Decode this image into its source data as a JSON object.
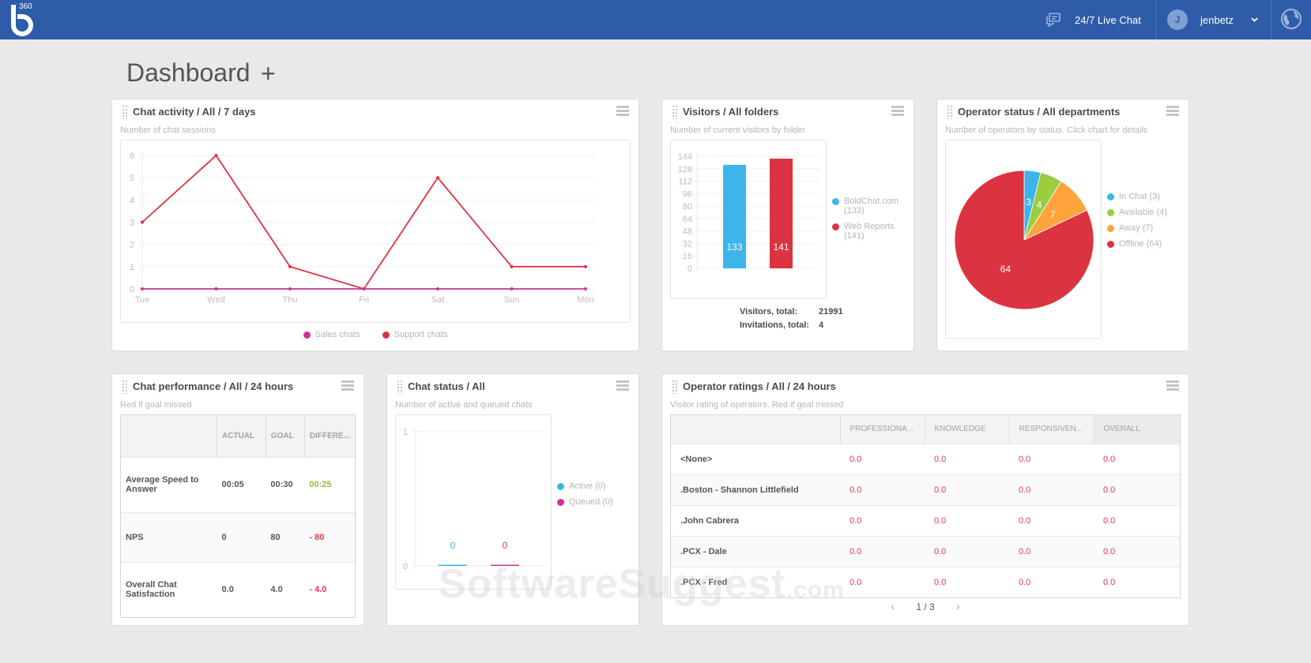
{
  "app": {
    "logo_text": "360",
    "live_chat_label": "24/7 Live Chat",
    "user_initial": "J",
    "username": "jenbetz"
  },
  "page": {
    "title": "Dashboard",
    "add_label": "+"
  },
  "widgets": {
    "chat_activity": {
      "title": "Chat activity / All / 7 days",
      "subtitle": "Number of chat sessions"
    },
    "visitors": {
      "title": "Visitors / All folders",
      "subtitle": "Number of current visitors by folder",
      "legend": [
        "BoldChat.com (133)",
        "Web Reports (141)"
      ],
      "totals": [
        {
          "label": "Visitors, total:",
          "value": "21991"
        },
        {
          "label": "Invitations, total:",
          "value": "4"
        }
      ]
    },
    "operator_status": {
      "title": "Operator status / All departments",
      "subtitle": "Number of operators by status. Click chart for details",
      "legend": [
        "In Chat (3)",
        "Available (4)",
        "Away (7)",
        "Offline (64)"
      ]
    },
    "chat_performance": {
      "title": "Chat performance / All / 24 hours",
      "subtitle": "Red if goal missed",
      "columns": [
        "",
        "ACTUAL",
        "GOAL",
        "DIFFERE..."
      ],
      "rows": [
        {
          "metric": "Average Speed to Answer",
          "actual": "00:05",
          "goal": "00:30",
          "difference": "00:25",
          "status": "good"
        },
        {
          "metric": "NPS",
          "actual": "0",
          "goal": "80",
          "difference": "- 80",
          "status": "missed"
        },
        {
          "metric": "Overall Chat Satisfaction",
          "actual": "0.0",
          "goal": "4.0",
          "difference": "- 4.0",
          "status": "missed"
        }
      ]
    },
    "chat_status": {
      "title": "Chat status / All",
      "subtitle": "Number of active and queued chats",
      "legend": [
        "Active (0)",
        "Queued (0)"
      ]
    },
    "operator_ratings": {
      "title": "Operator ratings / All / 24 hours",
      "subtitle": "Visitor rating of operators. Red if goal missed",
      "columns": [
        "",
        "PROFESSIONA...",
        "KNOWLEDGE",
        "RESPONSIVEN...",
        "OVERALL"
      ],
      "rows": [
        {
          "name": "<None>",
          "values": [
            "0.0",
            "0.0",
            "0.0",
            "0.0"
          ]
        },
        {
          "name": ".Boston - Shannon Littlefield",
          "values": [
            "0.0",
            "0.0",
            "0.0",
            "0.0"
          ]
        },
        {
          "name": ".John Cabrera",
          "values": [
            "0.0",
            "0.0",
            "0.0",
            "0.0"
          ]
        },
        {
          "name": ".PCX - Dale",
          "values": [
            "0.0",
            "0.0",
            "0.0",
            "0.0"
          ]
        },
        {
          "name": ".PCX - Fred",
          "values": [
            "0.0",
            "0.0",
            "0.0",
            "0.0"
          ]
        }
      ],
      "pager": "1 / 3"
    }
  },
  "colors": {
    "brand": "#2f5ca8",
    "red": "#dc3340",
    "blue": "#3db5ea",
    "magenta": "#cc3399",
    "green": "#9acd3f",
    "orange": "#ffa43c"
  },
  "watermark": {
    "main": "SoftwareSuggest",
    "suffix": ".com"
  },
  "chart_data": [
    {
      "type": "line",
      "title": "Chat activity / All / 7 days",
      "x": [
        "Tue",
        "Wed",
        "Thu",
        "Fri",
        "Sat",
        "Sun",
        "Mon"
      ],
      "series": [
        {
          "name": "Sales chats",
          "color": "#cc3399",
          "values": [
            0,
            0,
            0,
            0,
            0,
            0,
            0
          ]
        },
        {
          "name": "Support chats",
          "color": "#dc3340",
          "values": [
            3,
            6,
            1,
            0,
            5,
            1,
            1
          ]
        }
      ],
      "yticks": [
        0,
        1,
        2,
        3,
        4,
        5,
        6
      ],
      "ylim": [
        0,
        6
      ],
      "grid": true,
      "legend": "bottom"
    },
    {
      "type": "bar",
      "title": "Visitors / All folders",
      "categories": [
        "BoldChat.com",
        "Web Reports"
      ],
      "values": [
        133,
        141
      ],
      "colors": [
        "#3db5ea",
        "#dc3340"
      ],
      "yticks": [
        0,
        16,
        32,
        48,
        64,
        80,
        96,
        112,
        128,
        144
      ],
      "ylim": [
        0,
        144
      ],
      "grid": true,
      "legend": "right"
    },
    {
      "type": "pie",
      "title": "Operator status / All departments",
      "labels": [
        "In Chat",
        "Available",
        "Away",
        "Offline"
      ],
      "values": [
        3,
        4,
        7,
        64
      ],
      "colors": [
        "#3db5ea",
        "#9acd3f",
        "#ffa43c",
        "#dc3340"
      ],
      "legend": "right"
    },
    {
      "type": "bar",
      "title": "Chat status / All",
      "categories": [
        "Active",
        "Queued"
      ],
      "values": [
        0,
        0
      ],
      "colors": [
        "#3db5ea",
        "#cc3399"
      ],
      "yticks": [
        0,
        1
      ],
      "ylim": [
        0,
        1
      ],
      "legend": "right"
    }
  ]
}
